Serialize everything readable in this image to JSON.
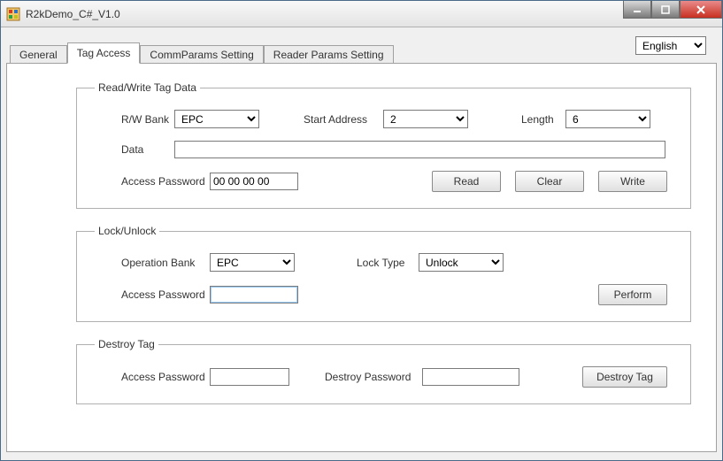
{
  "window": {
    "title": "R2kDemo_C#_V1.0"
  },
  "language": {
    "selected": "English"
  },
  "tabs": {
    "general": "General",
    "tag_access": "Tag Access",
    "comm_params": "CommParams Setting",
    "reader_params": "Reader Params Setting"
  },
  "readwrite": {
    "legend": "Read/Write Tag Data",
    "rw_bank_label": "R/W Bank",
    "rw_bank_value": "EPC",
    "start_addr_label": "Start Address",
    "start_addr_value": "2",
    "length_label": "Length",
    "length_value": "6",
    "data_label": "Data",
    "data_value": "",
    "access_pw_label": "Access Password",
    "access_pw_value": "00 00 00 00",
    "read_btn": "Read",
    "clear_btn": "Clear",
    "write_btn": "Write"
  },
  "lock": {
    "legend": "Lock/Unlock",
    "op_bank_label": "Operation Bank",
    "op_bank_value": "EPC",
    "lock_type_label": "Lock Type",
    "lock_type_value": "Unlock",
    "access_pw_label": "Access Password",
    "access_pw_value": "",
    "perform_btn": "Perform"
  },
  "destroy": {
    "legend": "Destroy Tag",
    "access_pw_label": "Access Password",
    "access_pw_value": "",
    "destroy_pw_label": "Destroy Password",
    "destroy_pw_value": "",
    "destroy_btn": "Destroy Tag"
  }
}
